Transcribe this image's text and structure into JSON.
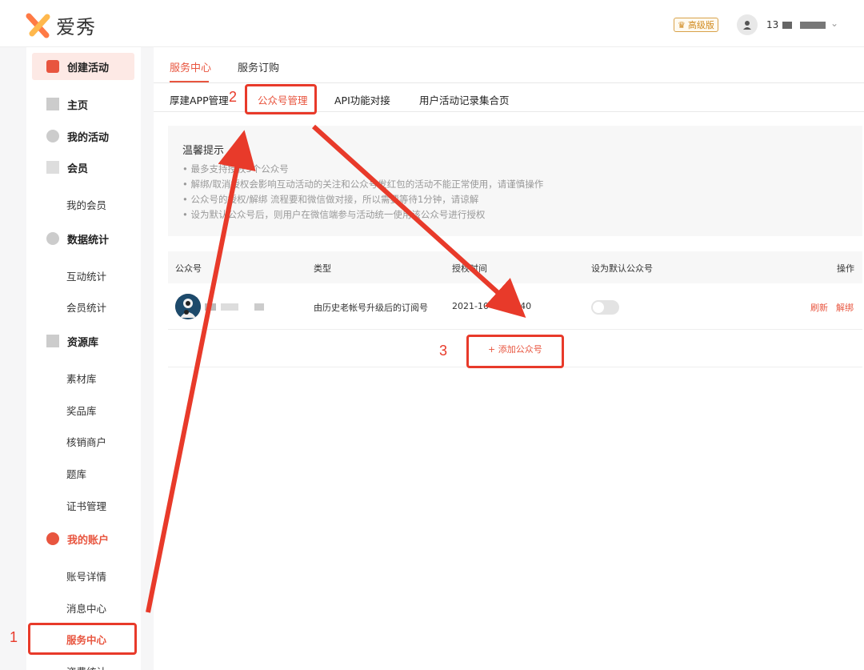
{
  "header": {
    "logo_text": "爱秀",
    "badge": "高级版",
    "user_name": "13"
  },
  "sidebar": {
    "create_label": "创建活动",
    "items": [
      {
        "label": "主页"
      },
      {
        "label": "我的活动"
      },
      {
        "label": "会员"
      },
      {
        "label": "我的会员"
      },
      {
        "label": "数据统计"
      },
      {
        "label": "互动统计"
      },
      {
        "label": "会员统计"
      },
      {
        "label": "资源库"
      },
      {
        "label": "素材库"
      },
      {
        "label": "奖品库"
      },
      {
        "label": "核销商户"
      },
      {
        "label": "题库"
      },
      {
        "label": "证书管理"
      },
      {
        "label": "我的账户"
      },
      {
        "label": "账号详情"
      },
      {
        "label": "消息中心"
      },
      {
        "label": "服务中心"
      },
      {
        "label": "资费统计"
      }
    ]
  },
  "tabs_top": [
    "服务中心",
    "服务订购"
  ],
  "tabs_sub": [
    "厚建APP管理",
    "公众号管理",
    "API功能对接",
    "用户活动记录集合页"
  ],
  "tip": {
    "title": "温馨提示",
    "lines": [
      "• 最多支持授权5个公众号",
      "• 解绑/取消授权会影响互动活动的关注和公众号发红包的活动不能正常使用，请谨慎操作",
      "• 公众号的授权/解绑 流程要和微信做对接，所以需要等待1分钟，请谅解",
      "• 设为默认公众号后，则用户在微信端参与活动统一使用该公众号进行授权"
    ]
  },
  "table": {
    "headers": [
      "公众号",
      "类型",
      "授权时间",
      "设为默认公众号",
      "操作"
    ],
    "row": {
      "type": "由历史老帐号升级后的订阅号",
      "time": "2021-10-08 11:40",
      "default_on": false,
      "actions": [
        "刷新",
        "解绑"
      ]
    },
    "add_label": "+ 添加公众号"
  },
  "annotations": [
    "1",
    "2",
    "3"
  ],
  "colors": {
    "accent": "#e8553f",
    "annotation": "#e83a2a"
  }
}
